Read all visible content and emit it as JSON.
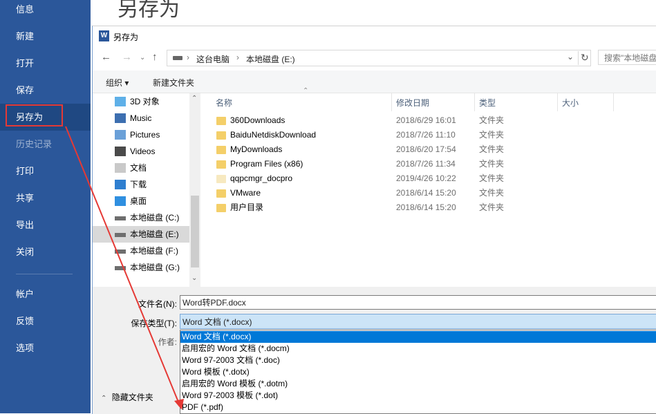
{
  "backstage": {
    "title": "另存为",
    "menu": {
      "info": "信息",
      "new": "新建",
      "open": "打开",
      "save": "保存",
      "save_as": "另存为",
      "history": "历史记录",
      "print": "打印",
      "share": "共享",
      "export": "导出",
      "close": "关闭",
      "account": "帐户",
      "feedback": "反馈",
      "options": "选项"
    }
  },
  "dialog": {
    "title": "另存为",
    "logo_letter": "W",
    "address": {
      "seg1": "这台电脑",
      "seg2": "本地磁盘 (E:)",
      "sep": "›",
      "refresh": "↻",
      "dropdown": "⌄"
    },
    "search_placeholder": "搜索\"本地磁盘",
    "toolbar": {
      "organize": "组织 ▾",
      "new_folder": "新建文件夹"
    },
    "nav": {
      "items": [
        {
          "label": "3D 对象",
          "icon": "3d-objects-icon"
        },
        {
          "label": "Music",
          "icon": "music-icon"
        },
        {
          "label": "Pictures",
          "icon": "pictures-icon"
        },
        {
          "label": "Videos",
          "icon": "videos-icon"
        },
        {
          "label": "文档",
          "icon": "documents-icon"
        },
        {
          "label": "下载",
          "icon": "downloads-icon"
        },
        {
          "label": "桌面",
          "icon": "desktop-icon"
        },
        {
          "label": "本地磁盘 (C:)",
          "icon": "drive-icon"
        },
        {
          "label": "本地磁盘 (E:)",
          "icon": "drive-icon"
        },
        {
          "label": "本地磁盘 (F:)",
          "icon": "drive-icon"
        },
        {
          "label": "本地磁盘 (G:)",
          "icon": "drive-icon"
        }
      ]
    },
    "columns": {
      "name": "名称",
      "date": "修改日期",
      "type": "类型",
      "size": "大小"
    },
    "files": [
      {
        "name": "360Downloads",
        "date": "2018/6/29 16:01",
        "type": "文件夹"
      },
      {
        "name": "BaiduNetdiskDownload",
        "date": "2018/7/26 11:10",
        "type": "文件夹"
      },
      {
        "name": "MyDownloads",
        "date": "2018/6/20 17:54",
        "type": "文件夹"
      },
      {
        "name": "Program Files (x86)",
        "date": "2018/7/26 11:34",
        "type": "文件夹"
      },
      {
        "name": "qqpcmgr_docpro",
        "date": "2019/4/26 10:22",
        "type": "文件夹"
      },
      {
        "name": "VMware",
        "date": "2018/6/14 15:20",
        "type": "文件夹"
      },
      {
        "name": "用户目录",
        "date": "2018/6/14 15:20",
        "type": "文件夹"
      }
    ],
    "form": {
      "filename_label": "文件名(N):",
      "filename_value": "Word转PDF.docx",
      "filetype_label": "保存类型(T):",
      "filetype_value": "Word 文档 (*.docx)",
      "author_label": "作者:"
    },
    "filetype_options": [
      "Word 文档 (*.docx)",
      "启用宏的 Word 文档 (*.docm)",
      "Word 97-2003 文档 (*.doc)",
      "Word 模板 (*.dotx)",
      "启用宏的 Word 模板 (*.dotm)",
      "Word 97-2003 模板 (*.dot)",
      "PDF (*.pdf)"
    ],
    "hide_folders": "隐藏文件夹"
  },
  "colors": {
    "sidebar": "#2b579a",
    "sidebar_active": "#1f4882",
    "annotation_red": "#e53935",
    "selection_blue": "#0078d7"
  }
}
